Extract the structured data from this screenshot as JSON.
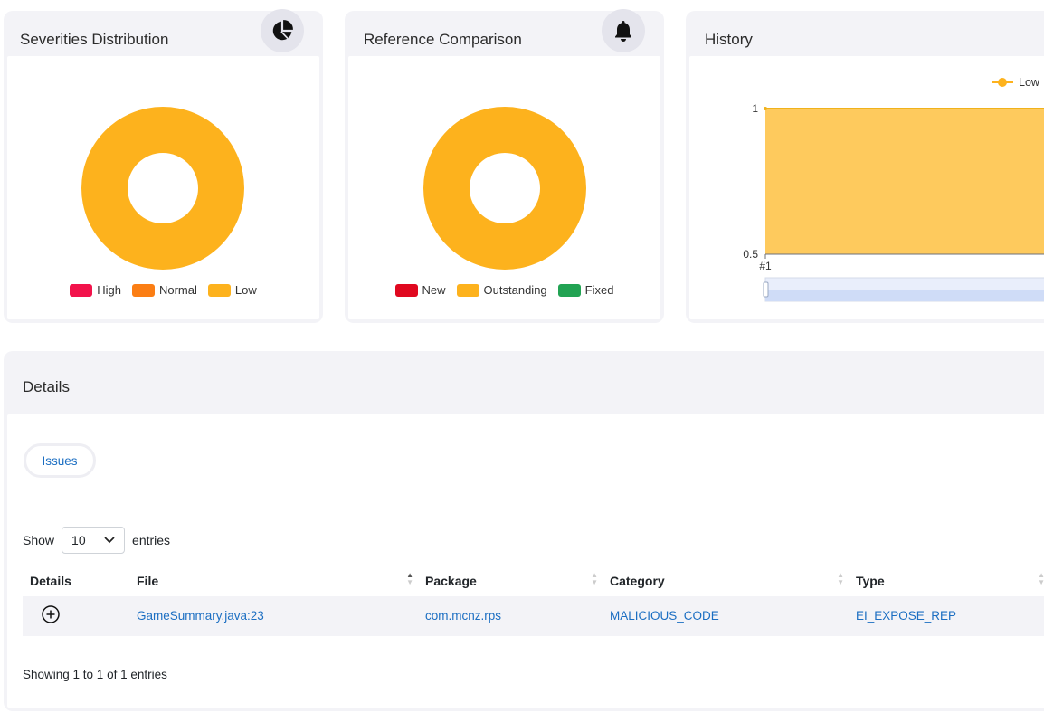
{
  "severities": {
    "title": "Severities Distribution",
    "icon": "pie-chart-icon",
    "legend": [
      {
        "label": "High",
        "color": "#f2134b"
      },
      {
        "label": "Normal",
        "color": "#fb7e14"
      },
      {
        "label": "Low",
        "color": "#fdb21d"
      }
    ]
  },
  "reference": {
    "title": "Reference Comparison",
    "icon": "bell-icon",
    "legend": [
      {
        "label": "New",
        "color": "#e0081f"
      },
      {
        "label": "Outstanding",
        "color": "#fdb21d"
      },
      {
        "label": "Fixed",
        "color": "#22a353"
      }
    ]
  },
  "history": {
    "title": "History",
    "legend_label": "Low"
  },
  "chart_data": [
    {
      "type": "pie",
      "title": "Severities Distribution",
      "categories": [
        "High",
        "Normal",
        "Low"
      ],
      "values": [
        0,
        0,
        1
      ],
      "colors": [
        "#f2134b",
        "#fb7e14",
        "#fdb21d"
      ],
      "legend": "bottom"
    },
    {
      "type": "pie",
      "title": "Reference Comparison",
      "categories": [
        "New",
        "Outstanding",
        "Fixed"
      ],
      "values": [
        0,
        1,
        0
      ],
      "colors": [
        "#e0081f",
        "#fdb21d",
        "#22a353"
      ],
      "legend": "bottom"
    },
    {
      "type": "area",
      "title": "History",
      "x": [
        "#1"
      ],
      "series": [
        {
          "name": "Low",
          "values": [
            1
          ],
          "color": "#fdb21d"
        }
      ],
      "ylim": [
        0.5,
        1
      ],
      "yticks": [
        "1",
        "0.5"
      ],
      "legend": "top-right"
    }
  ],
  "details": {
    "title": "Details",
    "tab_label": "Issues",
    "show_label": "Show",
    "entries_label": "entries",
    "page_size": "10",
    "columns": [
      "Details",
      "File",
      "Package",
      "Category",
      "Type"
    ],
    "rows": [
      {
        "file": "GameSummary.java:23",
        "package": "com.mcnz.rps",
        "category": "MALICIOUS_CODE",
        "type": "EI_EXPOSE_REP"
      }
    ],
    "info": "Showing 1 to 1 of 1 entries"
  }
}
